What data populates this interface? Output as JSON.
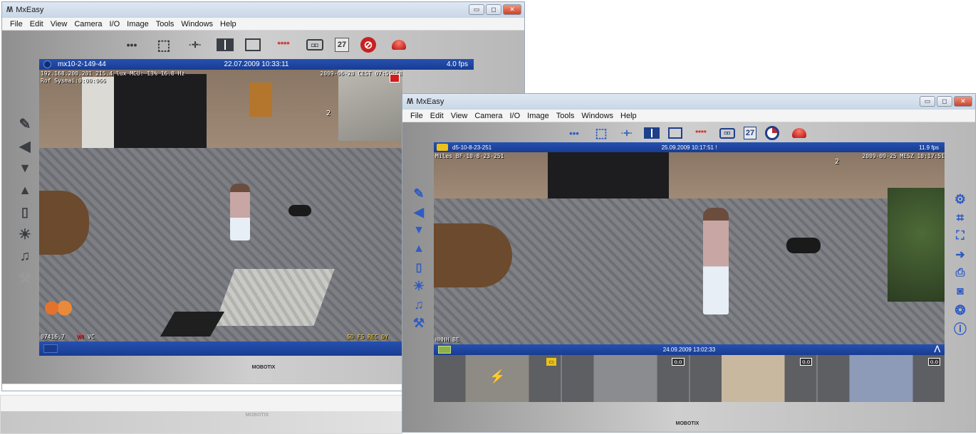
{
  "left_window": {
    "title": "MxEasy",
    "logo": "/\\/\\",
    "window_controls": {
      "minimize": "▭",
      "maximize": "◻",
      "close": "✕"
    },
    "menu": [
      "File",
      "Edit",
      "View",
      "Camera",
      "I/O",
      "Image",
      "Tools",
      "Windows",
      "Help"
    ],
    "toolbar": [
      {
        "icon": "dots-icon",
        "glyph": "•••"
      },
      {
        "icon": "grid-select-icon",
        "glyph": "⬚"
      },
      {
        "icon": "move-icon",
        "glyph": "·✛·"
      },
      {
        "icon": "split-layout-icon",
        "glyph": ""
      },
      {
        "icon": "zoom-frame-icon",
        "glyph": "⌑"
      },
      {
        "icon": "password-key-icon",
        "glyph": "****"
      },
      {
        "icon": "recorder-icon",
        "glyph": "◘◘"
      },
      {
        "icon": "calendar-icon",
        "glyph": "27"
      },
      {
        "icon": "no-alarm-icon",
        "glyph": "⊘"
      },
      {
        "icon": "alarm-light-icon",
        "glyph": ""
      }
    ],
    "camera_bar": {
      "camera": "mx10-2-149-44",
      "timestamp": "22.07.2009 10:33:11",
      "fps": "4.0 fps"
    },
    "overlay": {
      "top_left_1": "192.168.200.201  215.4 lux  MCU: 13%  16.8 Hz",
      "top_left_2": "Rof Sysmai:0:00:066",
      "top_right": "2009-06-28 CEST 07:56:58",
      "bottom_left_1": "07416.7",
      "bottom_left_2": "VM",
      "bottom_left_3": "VC",
      "bottom_right": "SD FS REC DY",
      "marker": "2"
    },
    "side_icons": [
      "microphone-icon",
      "speaker-icon",
      "ptz-down-icon",
      "ptz-up-icon",
      "door-icon",
      "light-icon",
      "bell-icon",
      "wrench-icon"
    ],
    "brand": "MOBOTIX"
  },
  "right_window": {
    "title": "MxEasy",
    "logo": "/\\/\\",
    "window_controls": {
      "minimize": "▭",
      "maximize": "◻",
      "close": "✕"
    },
    "menu": [
      "File",
      "Edit",
      "View",
      "Camera",
      "I/O",
      "Image",
      "Tools",
      "Windows",
      "Help"
    ],
    "camera_bar": {
      "camera": "d5-10-8-23-251",
      "timestamp": "25.09.2009 10:17:51 !",
      "fps": "11.9 fps"
    },
    "overlay": {
      "top_left": "Miles BF-10-8-23-251",
      "top_right": "2009-09-25 MESZ 10:17:51",
      "bottom_left": "HHHH BE",
      "marker": "2"
    },
    "left_icons": [
      "microphone-icon",
      "speaker-icon",
      "ptz-down-icon",
      "ptz-up-icon",
      "door-icon",
      "light-icon",
      "bell-icon",
      "wrench-icon"
    ],
    "right_icons": [
      "settings-icon",
      "crop-icon",
      "expand-icon",
      "login-icon",
      "print-icon",
      "snapshot-icon",
      "help-lifebuoy-icon",
      "info-icon"
    ],
    "playback_bar": {
      "timestamp": "24.09.2009 13:02:33"
    },
    "thumb_tags": [
      "▭",
      "o.o",
      "o.o",
      "o.o"
    ],
    "brand": "MOBOTIX"
  },
  "background_window": {
    "brand": "MOBOTIX"
  },
  "colors": {
    "camera_bar": "#1f48a6",
    "overlay_yellow": "#ffd23a",
    "icon_blue": "#2f5bc4"
  }
}
